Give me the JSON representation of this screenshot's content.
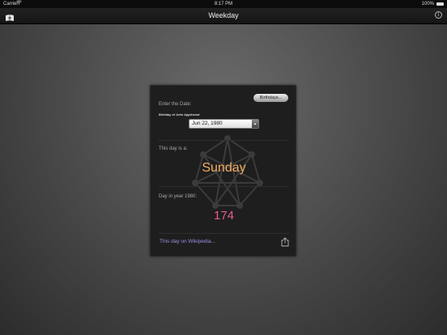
{
  "status_bar": {
    "carrier": "Carrier",
    "time": "8:17 PM",
    "battery": "100%"
  },
  "nav": {
    "title": "Weekday",
    "left_icon": "book-icon",
    "right_icon": "info-icon",
    "info_glyph": "i"
  },
  "panel": {
    "birthdays_button": "Birthdays...",
    "enter_date_label": "Enter the Date:",
    "birthday_of_label": "Birthday of John Appleseed",
    "date_value": "Jun 22, 1980",
    "this_day_label": "This day is a:",
    "weekday": "Sunday",
    "day_in_year_label": "Day in year 1980:",
    "day_number": "174",
    "wikipedia_link": "This day on Wikipedia...",
    "share_icon": "share-icon"
  },
  "colors": {
    "weekday": "#f3ae62",
    "day_number": "#e85a93",
    "link": "#9f8fe0"
  }
}
